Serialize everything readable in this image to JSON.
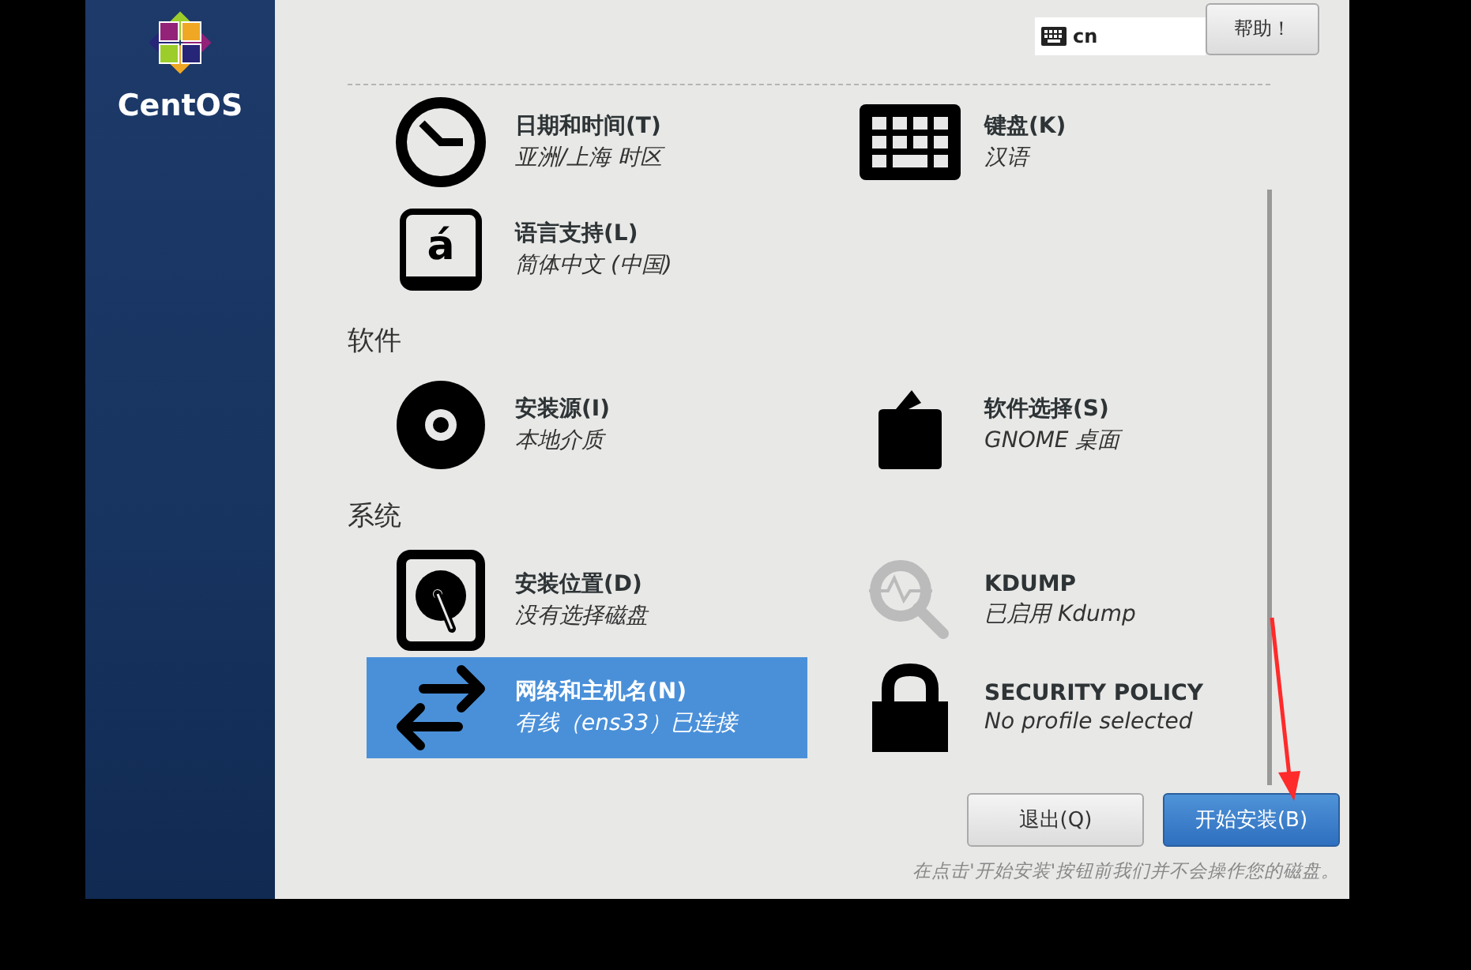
{
  "sidebar": {
    "logo_text": "CentOS"
  },
  "header": {
    "keyboard_layout": "cn",
    "help_button": "帮助！"
  },
  "sections": [
    {
      "items": [
        {
          "kind": "clock",
          "title": "日期和时间(T)",
          "subtitle": "亚洲/上海 时区",
          "selected": false
        },
        {
          "kind": "keyboard",
          "title": "键盘(K)",
          "subtitle": "汉语",
          "selected": false
        },
        {
          "kind": "language",
          "glyph": "á",
          "title": "语言支持(L)",
          "subtitle": "简体中文 (中国)",
          "selected": false
        }
      ]
    },
    {
      "heading": "软件",
      "items": [
        {
          "kind": "disc",
          "title": "安装源(I)",
          "subtitle": "本地介质",
          "selected": false
        },
        {
          "kind": "package",
          "title": "软件选择(S)",
          "subtitle": "GNOME 桌面",
          "selected": false
        }
      ]
    },
    {
      "heading": "系统",
      "items": [
        {
          "kind": "harddisk",
          "title": "安装位置(D)",
          "subtitle": "没有选择磁盘",
          "selected": false
        },
        {
          "kind": "magnifier",
          "title": "KDUMP",
          "subtitle": "已启用 Kdump",
          "selected": false
        },
        {
          "kind": "arrows",
          "title": "网络和主机名(N)",
          "subtitle": "有线（ens33）已连接",
          "selected": true
        },
        {
          "kind": "lock",
          "title": "SECURITY POLICY",
          "subtitle": "No profile selected",
          "selected": false
        }
      ]
    }
  ],
  "footer": {
    "buttons": [
      {
        "label": "退出(Q)",
        "kind": "normal"
      },
      {
        "label": "开始安装(B)",
        "kind": "primary"
      }
    ],
    "note": "在点击'开始安装'按钮前我们并不会操作您的磁盘。"
  }
}
